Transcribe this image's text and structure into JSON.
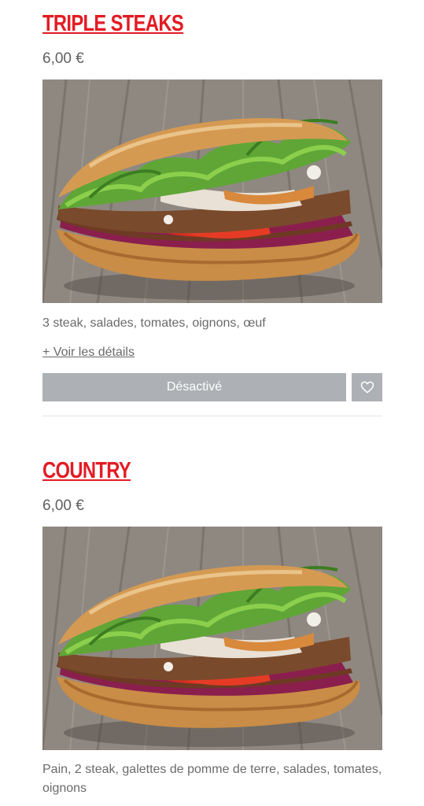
{
  "products": [
    {
      "name": "TRIPLE STEAKS",
      "price": "6,00 €",
      "description": "3 steak, salades, tomates, oignons, œuf",
      "details_link": "+ Voir les détails",
      "button_label": "Désactivé",
      "fav_icon": "heart-outline-icon"
    },
    {
      "name": "COUNTRY",
      "price": "6,00 €",
      "description": "Pain, 2 steak, galettes de pomme de terre, salades, tomates, oignons"
    }
  ],
  "colors": {
    "title": "#e31b23",
    "price_text": "#606060",
    "button_bg": "#adb1b5",
    "button_text": "#ffffff",
    "divider": "#e3e3e3"
  }
}
